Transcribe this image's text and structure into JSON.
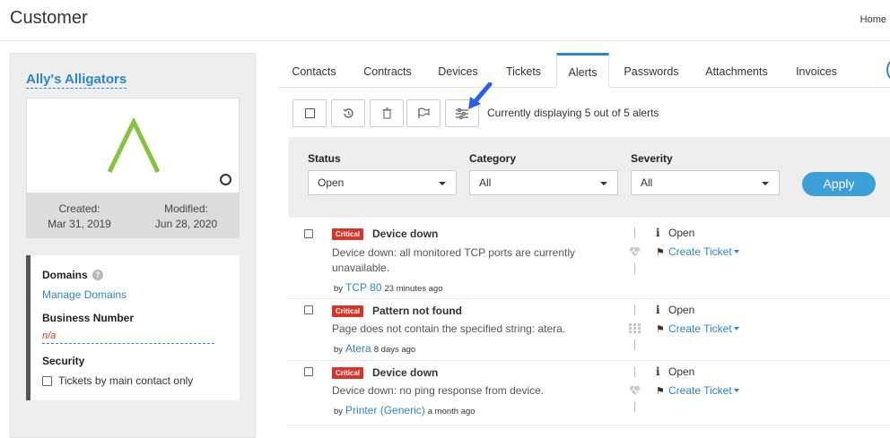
{
  "header": {
    "title": "Customer",
    "home_link": "Home"
  },
  "customer": {
    "name": "Ally's Alligators",
    "created_label": "Created:",
    "created_date": "Mar 31, 2019",
    "modified_label": "Modified:",
    "modified_date": "Jun 28, 2020",
    "domains_label": "Domains",
    "domains_help": "?",
    "manage_domains": "Manage Domains",
    "business_number_label": "Business Number",
    "business_number_value": "n/a",
    "security_label": "Security",
    "security_option": "Tickets by main contact only",
    "accent_color": "#2e86c9"
  },
  "tabs": [
    {
      "label": "Contacts"
    },
    {
      "label": "Contracts"
    },
    {
      "label": "Devices"
    },
    {
      "label": "Tickets"
    },
    {
      "label": "Alerts",
      "active": true
    },
    {
      "label": "Passwords"
    },
    {
      "label": "Attachments"
    },
    {
      "label": "Invoices"
    }
  ],
  "toolbar": {
    "icons": [
      "select-all-icon",
      "history-icon",
      "trash-icon",
      "flag-icon",
      "filter-sliders-icon"
    ],
    "count_text": "Currently displaying 5 out of 5 alerts"
  },
  "filters": {
    "status": {
      "label": "Status",
      "value": "Open"
    },
    "category": {
      "label": "Category",
      "value": "All"
    },
    "severity": {
      "label": "Severity",
      "value": "All"
    },
    "apply_label": "Apply"
  },
  "alerts": [
    {
      "severity": "Critical",
      "title": "Device down",
      "description": "Device down: all monitored TCP ports are currently unavailable.",
      "by_label": "by",
      "source": "TCP 80",
      "time": "23 minutes ago",
      "icon": "heartbeat-icon",
      "status": "Open",
      "ticket_action": "Create Ticket"
    },
    {
      "severity": "Critical",
      "title": "Pattern not found",
      "description": "Page does not contain the specified string: atera.",
      "by_label": "by",
      "source": "Atera",
      "time": "8 days ago",
      "icon": "grid-icon",
      "status": "Open",
      "ticket_action": "Create Ticket"
    },
    {
      "severity": "Critical",
      "title": "Device down",
      "description": "Device down: no ping response from device.",
      "by_label": "by",
      "source": "Printer (Generic)",
      "time": "a month ago",
      "icon": "heartbeat-icon",
      "status": "Open",
      "ticket_action": "Create Ticket"
    }
  ]
}
